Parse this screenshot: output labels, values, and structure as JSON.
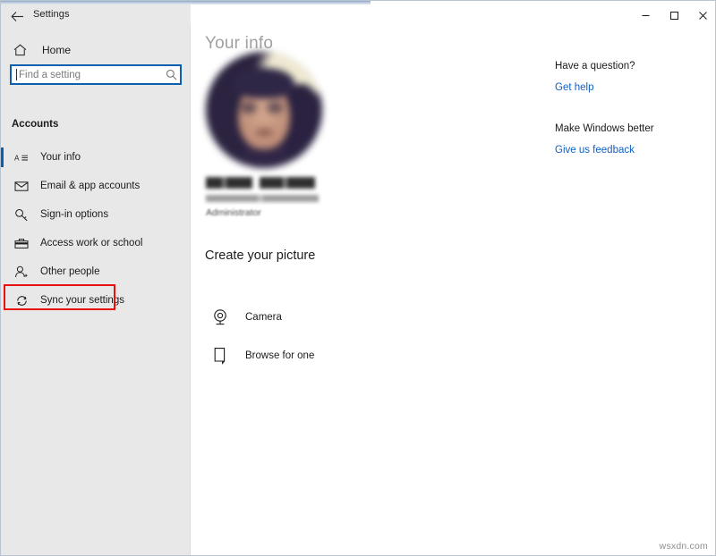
{
  "window": {
    "title": "Settings",
    "back_icon": "back-arrow-icon",
    "controls": {
      "minimize": "minimize-icon",
      "maximize": "maximize-icon",
      "close": "close-icon"
    }
  },
  "sidebar": {
    "home": {
      "label": "Home",
      "icon": "home-icon"
    },
    "search": {
      "value": "",
      "placeholder": "Find a setting",
      "icon": "search-icon"
    },
    "section_header": "Accounts",
    "selection_accent": "#0b5fb0",
    "items": [
      {
        "label": "Your info",
        "icon": "id-card-icon",
        "selected": true
      },
      {
        "label": "Email & app accounts",
        "icon": "envelope-icon",
        "selected": false
      },
      {
        "label": "Sign-in options",
        "icon": "key-icon",
        "selected": false
      },
      {
        "label": "Access work or school",
        "icon": "briefcase-icon",
        "selected": false
      },
      {
        "label": "Other people",
        "icon": "person-add-icon",
        "selected": false
      },
      {
        "label": "Sync your settings",
        "icon": "sync-icon",
        "selected": false
      }
    ],
    "annotation": {
      "target": "Sync your settings",
      "color": "#e81010"
    }
  },
  "main": {
    "page_title": "Your info",
    "account": {
      "avatar": "user-avatar-photo",
      "name": "",
      "email": "",
      "role": "Administrator"
    },
    "create_picture": {
      "title": "Create your picture",
      "options": [
        {
          "label": "Camera",
          "icon": "webcam-icon"
        },
        {
          "label": "Browse for one",
          "icon": "document-icon"
        }
      ]
    }
  },
  "info_column": {
    "blocks": [
      {
        "heading": "Have a question?",
        "link": "Get help"
      },
      {
        "heading": "Make Windows better",
        "link": "Give us feedback"
      }
    ],
    "link_color": "#1060c0"
  },
  "watermark": "wsxdn.com"
}
